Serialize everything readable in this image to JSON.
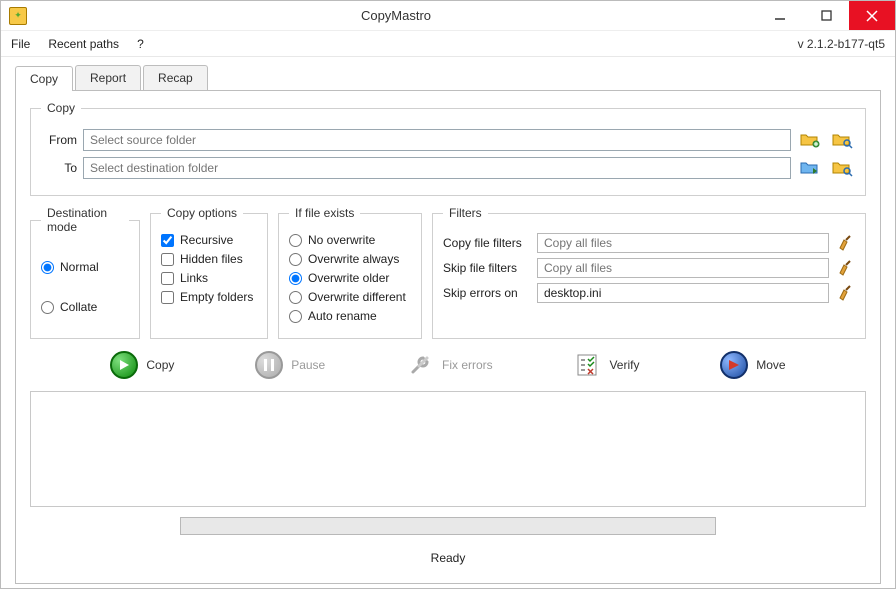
{
  "window": {
    "title": "CopyMastro"
  },
  "menu": {
    "file": "File",
    "recent": "Recent paths",
    "help": "?",
    "version": "v 2.1.2-b177-qt5"
  },
  "tabs": {
    "copy": "Copy",
    "report": "Report",
    "recap": "Recap"
  },
  "section_copy": {
    "legend": "Copy",
    "from_label": "From",
    "from_placeholder": "Select source folder",
    "to_label": "To",
    "to_placeholder": "Select destination folder"
  },
  "dest_mode": {
    "legend": "Destination mode",
    "normal": "Normal",
    "collate": "Collate"
  },
  "copy_options": {
    "legend": "Copy options",
    "recursive": "Recursive",
    "hidden": "Hidden files",
    "links": "Links",
    "empty": "Empty folders"
  },
  "if_exists": {
    "legend": "If file exists",
    "no_overwrite": "No overwrite",
    "always": "Overwrite always",
    "older": "Overwrite older",
    "different": "Overwrite different",
    "auto": "Auto rename"
  },
  "filters": {
    "legend": "Filters",
    "copy_label": "Copy file filters",
    "copy_placeholder": "Copy all files",
    "skip_label": "Skip file filters",
    "skip_placeholder": "Copy all files",
    "errors_label": "Skip errors on",
    "errors_value": "desktop.ini"
  },
  "actions": {
    "copy": "Copy",
    "pause": "Pause",
    "fix": "Fix errors",
    "verify": "Verify",
    "move": "Move"
  },
  "status": "Ready"
}
